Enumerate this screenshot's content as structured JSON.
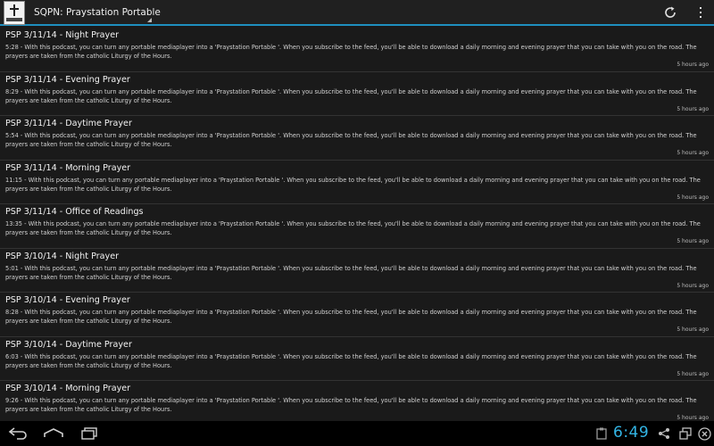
{
  "action_bar": {
    "title": "SQPN: Praystation Portable"
  },
  "episodes": [
    {
      "title": "PSP 3/11/14 - Night Prayer",
      "description": "5:28 - With this podcast, you can turn any portable mediaplayer into a 'Praystation Portable '. When you subscribe to the feed, you'll be able to download a daily morning and evening prayer that you can take with you on the road. The prayers are taken from the catholic Liturgy of the Hours.",
      "time": "5 hours ago"
    },
    {
      "title": "PSP 3/11/14 - Evening Prayer",
      "description": "8:29 - With this podcast, you can turn any portable mediaplayer into a 'Praystation Portable '. When you subscribe to the feed, you'll be able to download a daily morning and evening prayer that you can take with you on the road. The prayers are taken from the catholic Liturgy of the Hours.",
      "time": "5 hours ago"
    },
    {
      "title": "PSP 3/11/14 - Daytime Prayer",
      "description": "5:54 - With this podcast, you can turn any portable mediaplayer into a 'Praystation Portable '. When you subscribe to the feed, you'll be able to download a daily morning and evening prayer that you can take with you on the road. The prayers are taken from the catholic Liturgy of the Hours.",
      "time": "5 hours ago"
    },
    {
      "title": "PSP 3/11/14 - Morning Prayer",
      "description": "11:15 - With this podcast, you can turn any portable mediaplayer into a 'Praystation Portable '. When you subscribe to the feed, you'll be able to download a daily morning and evening prayer that you can take with you on the road. The prayers are taken from the catholic Liturgy of the Hours.",
      "time": "5 hours ago"
    },
    {
      "title": "PSP 3/11/14 - Office of Readings",
      "description": "13:35 - With this podcast, you can turn any portable mediaplayer into a 'Praystation Portable '. When you subscribe to the feed, you'll be able to download a daily morning and evening prayer that you can take with you on the road. The prayers are taken from the catholic Liturgy of the Hours.",
      "time": "5 hours ago"
    },
    {
      "title": "PSP 3/10/14 - Night Prayer",
      "description": "5:01 - With this podcast, you can turn any portable mediaplayer into a 'Praystation Portable '. When you subscribe to the feed, you'll be able to download a daily morning and evening prayer that you can take with you on the road. The prayers are taken from the catholic Liturgy of the Hours.",
      "time": "5 hours ago"
    },
    {
      "title": "PSP 3/10/14 - Evening Prayer",
      "description": "8:28 - With this podcast, you can turn any portable mediaplayer into a 'Praystation Portable '. When you subscribe to the feed, you'll be able to download a daily morning and evening prayer that you can take with you on the road. The prayers are taken from the catholic Liturgy of the Hours.",
      "time": "5 hours ago"
    },
    {
      "title": "PSP 3/10/14 - Daytime Prayer",
      "description": "6:03 - With this podcast, you can turn any portable mediaplayer into a 'Praystation Portable '. When you subscribe to the feed, you'll be able to download a daily morning and evening prayer that you can take with you on the road. The prayers are taken from the catholic Liturgy of the Hours.",
      "time": "5 hours ago"
    },
    {
      "title": "PSP 3/10/14 - Morning Prayer",
      "description": "9:26 - With this podcast, you can turn any portable mediaplayer into a 'Praystation Portable '. When you subscribe to the feed, you'll be able to download a daily morning and evening prayer that you can take with you on the road. The prayers are taken from the catholic Liturgy of the Hours.",
      "time": "5 hours ago"
    }
  ],
  "system_bar": {
    "clock": "6:49",
    "accent_color": "#33b5e5"
  },
  "icons": {
    "app": "podcast-cover-icon",
    "refresh": "refresh-icon",
    "overflow": "overflow-menu-icon",
    "back": "back-icon",
    "home": "home-icon",
    "recent": "recent-apps-icon"
  }
}
